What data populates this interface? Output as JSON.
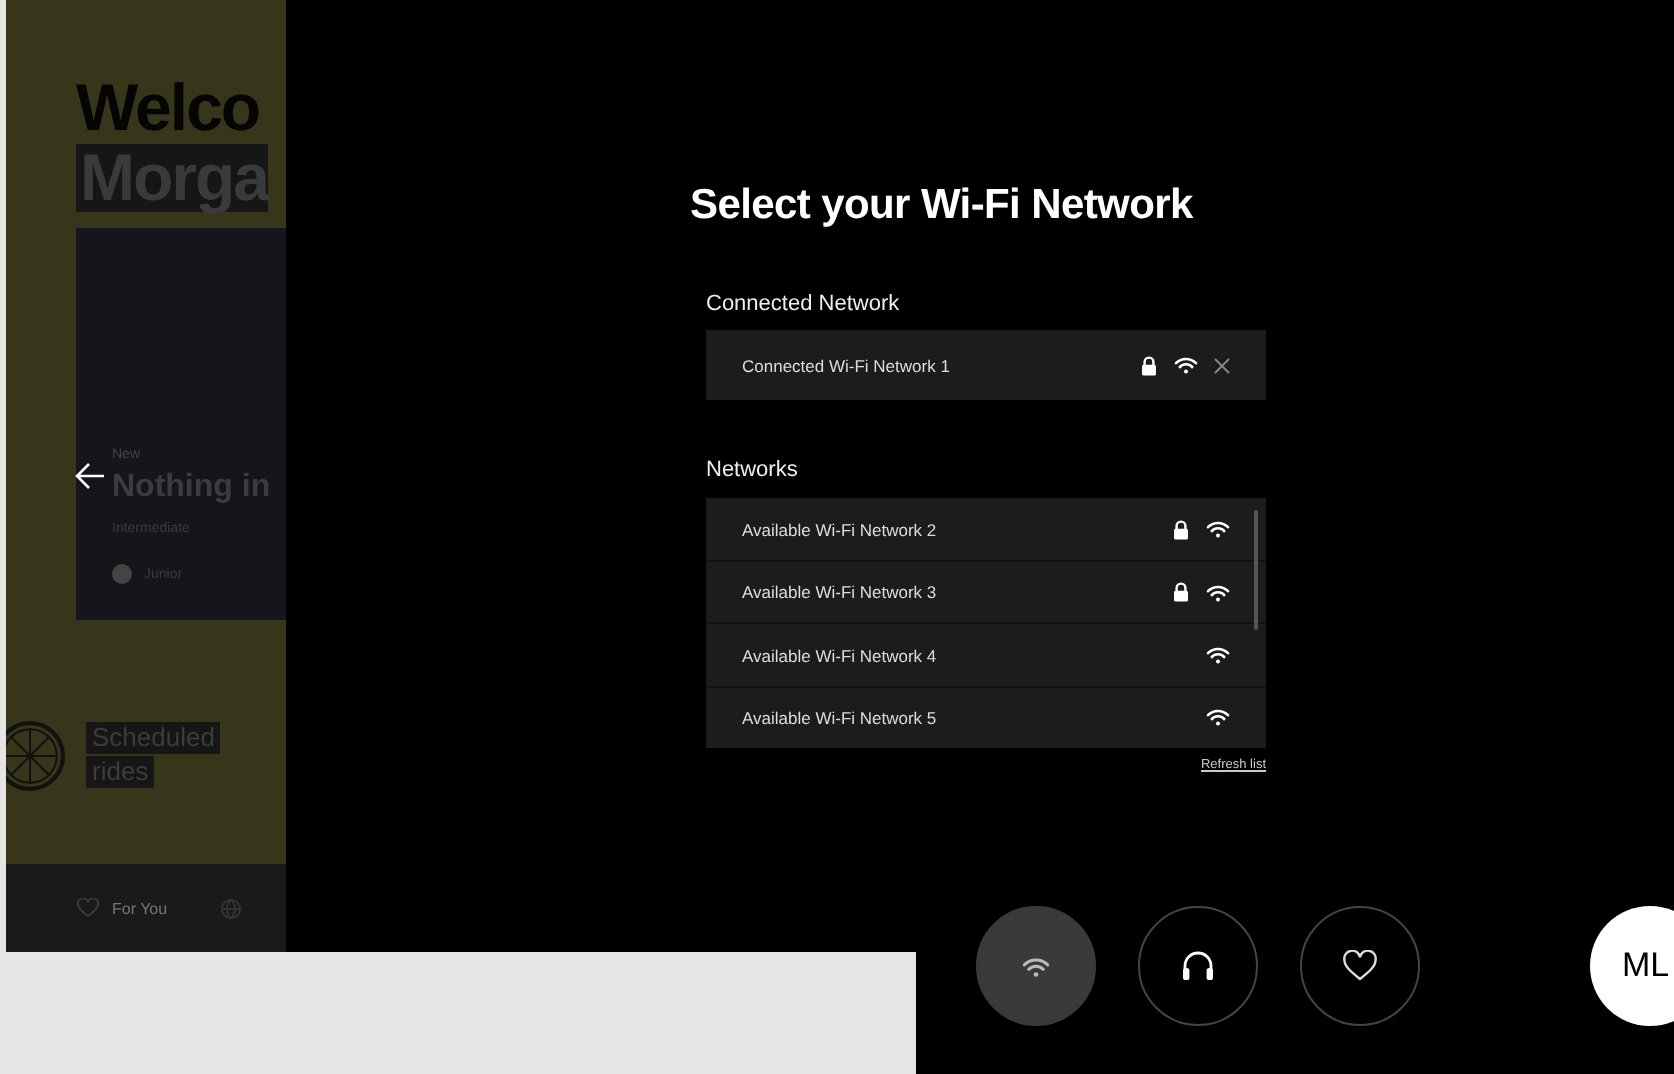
{
  "background_app": {
    "greeting": [
      "Welco",
      "Morga"
    ],
    "featured_ride": {
      "badge": "New",
      "title": "Nothing in",
      "difficulty": "Intermediate",
      "instructor": "Junior"
    },
    "scheduled": [
      "Scheduled",
      "rides"
    ],
    "nav": [
      {
        "label": "For You"
      }
    ]
  },
  "modal": {
    "title": "Select your Wi-Fi Network",
    "connected": {
      "heading": "Connected Network",
      "network": {
        "name": "Connected Wi-Fi Network 1",
        "secured": true
      }
    },
    "available": {
      "heading": "Networks",
      "networks": [
        {
          "name": "Available Wi-Fi Network 2",
          "secured": true
        },
        {
          "name": "Available Wi-Fi Network 3",
          "secured": true
        },
        {
          "name": "Available Wi-Fi Network 4",
          "secured": false
        },
        {
          "name": "Available Wi-Fi Network 5",
          "secured": false
        }
      ]
    },
    "refresh_link": "Refresh list"
  },
  "dock": {
    "buttons": [
      {
        "kind": "wifi",
        "selected": true
      },
      {
        "kind": "headphones",
        "selected": false
      },
      {
        "kind": "favorites",
        "selected": false
      }
    ],
    "avatar": {
      "initials": "ML"
    }
  }
}
